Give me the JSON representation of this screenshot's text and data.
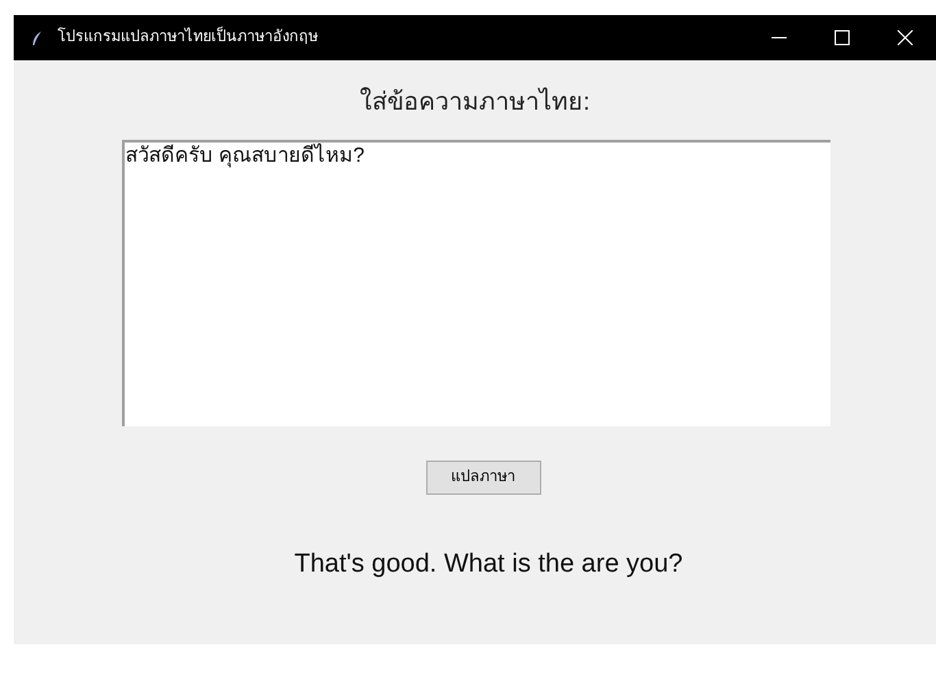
{
  "window": {
    "title": "โปรแกรมแปลภาษาไทยเป็นภาษาอังกฤษ"
  },
  "prompt": "ใส่ข้อความภาษาไทย:",
  "input": {
    "value": "สวัสดีครับ คุณสบายดีไหม?"
  },
  "button": {
    "label": "แปลภาษา"
  },
  "result": "That's good. What is the are you?"
}
